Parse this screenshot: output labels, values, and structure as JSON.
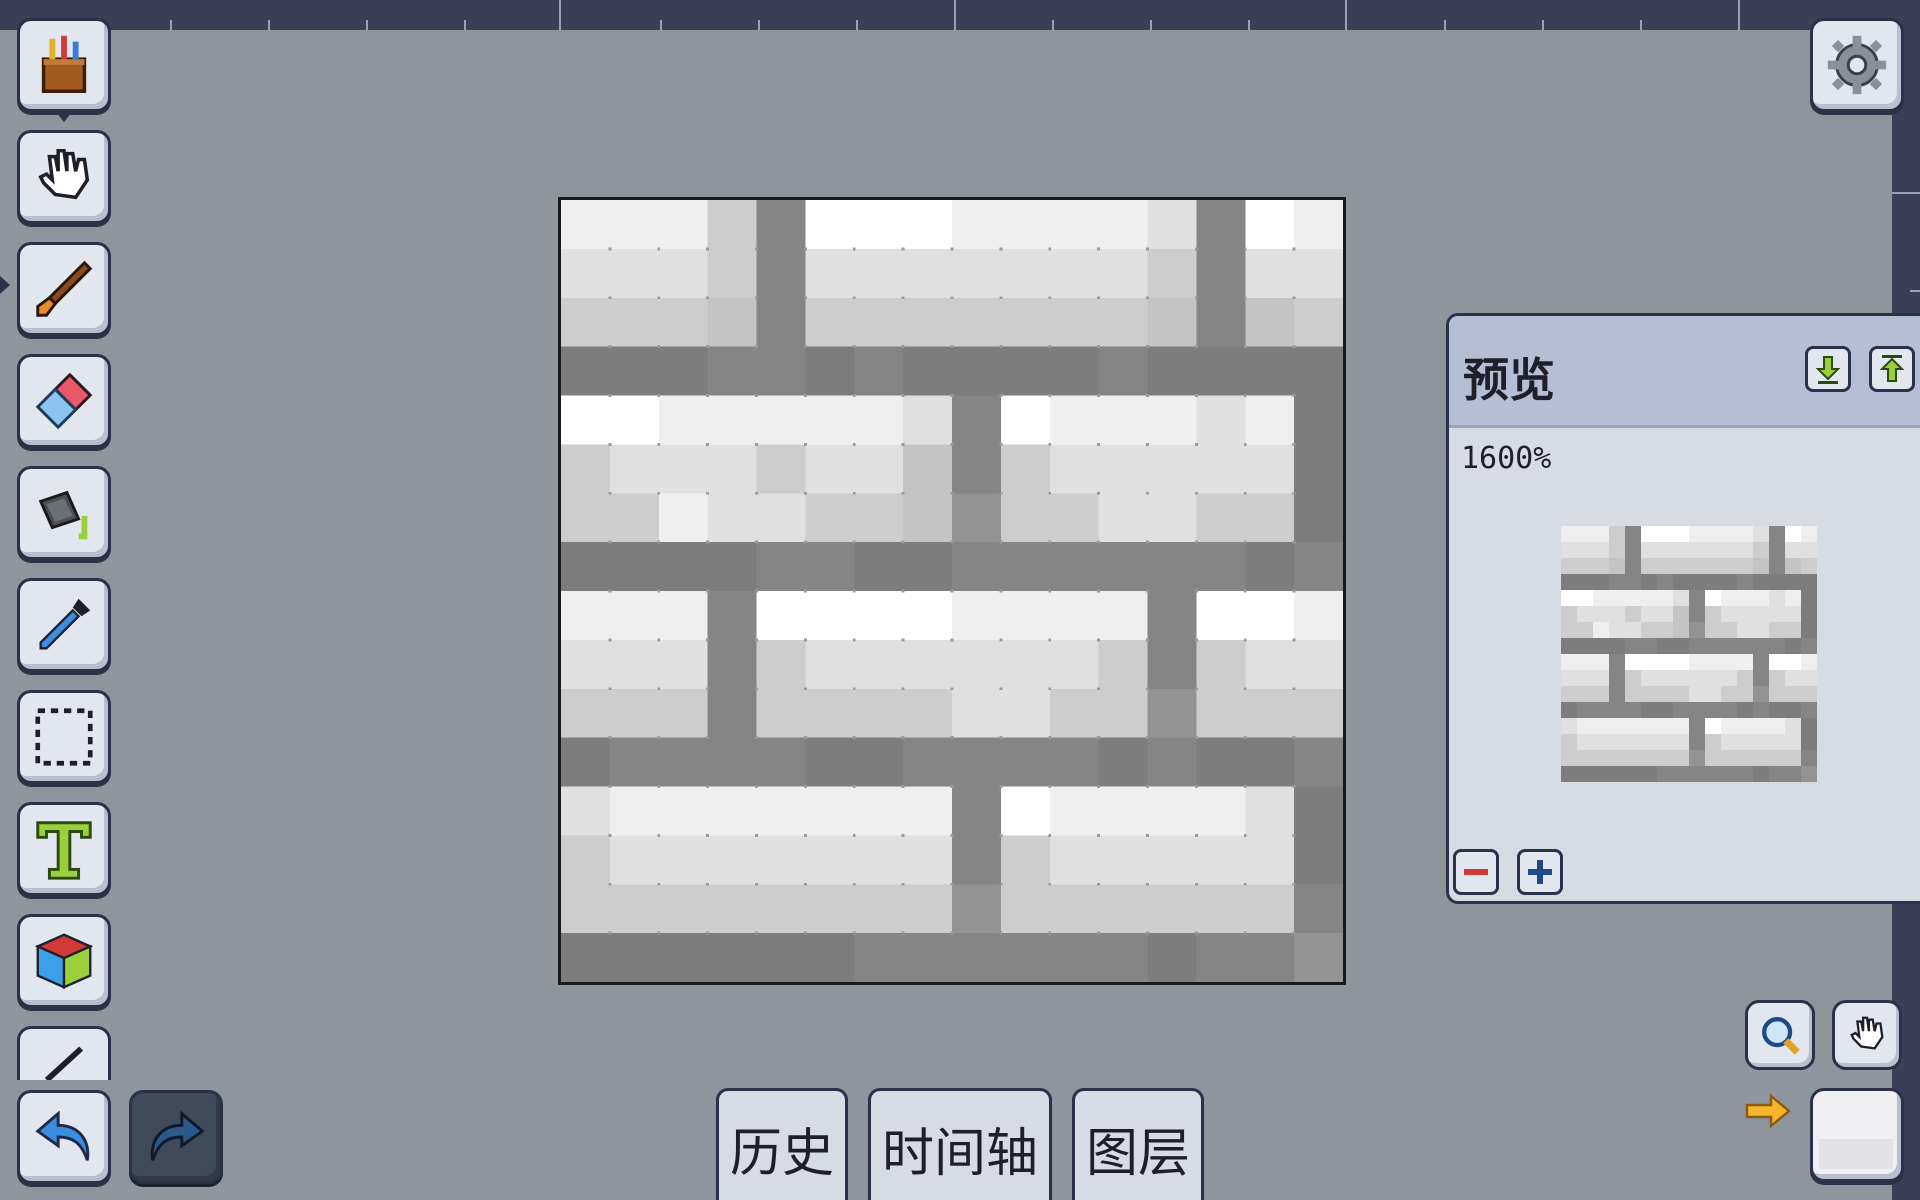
{
  "app": {
    "background": "#8e959d"
  },
  "tools": [
    {
      "id": "palette",
      "icon": "paint-bucket-brushes-icon"
    },
    {
      "id": "hand",
      "icon": "glove-hand-icon"
    },
    {
      "id": "brush",
      "icon": "brush-icon"
    },
    {
      "id": "eraser",
      "icon": "eraser-icon"
    },
    {
      "id": "fill",
      "icon": "fill-bucket-icon"
    },
    {
      "id": "eyedropper",
      "icon": "eyedropper-icon"
    },
    {
      "id": "select",
      "icon": "rectangle-select-icon"
    },
    {
      "id": "text",
      "icon": "text-tool-icon"
    },
    {
      "id": "shape3d",
      "icon": "cube-icon"
    },
    {
      "id": "line",
      "icon": "line-tool-icon"
    }
  ],
  "history": {
    "undo_icon": "undo-arrow-icon",
    "redo_icon": "redo-arrow-icon"
  },
  "settings": {
    "icon": "gear-icon"
  },
  "preview": {
    "title": "预览",
    "zoom": "1600%",
    "download_icon": "arrow-down-icon",
    "upload_icon": "arrow-up-icon",
    "zoom_out_icon": "minus-icon",
    "zoom_in_icon": "plus-icon"
  },
  "tabs": [
    {
      "label": "历史"
    },
    {
      "label": "时间轴"
    },
    {
      "label": "图层"
    }
  ],
  "colors": {
    "accent_dark": "#2c3048",
    "panel": "#d7dbe3",
    "panel_header": "#b4bed4",
    "current_color": "#f0f0f2"
  }
}
